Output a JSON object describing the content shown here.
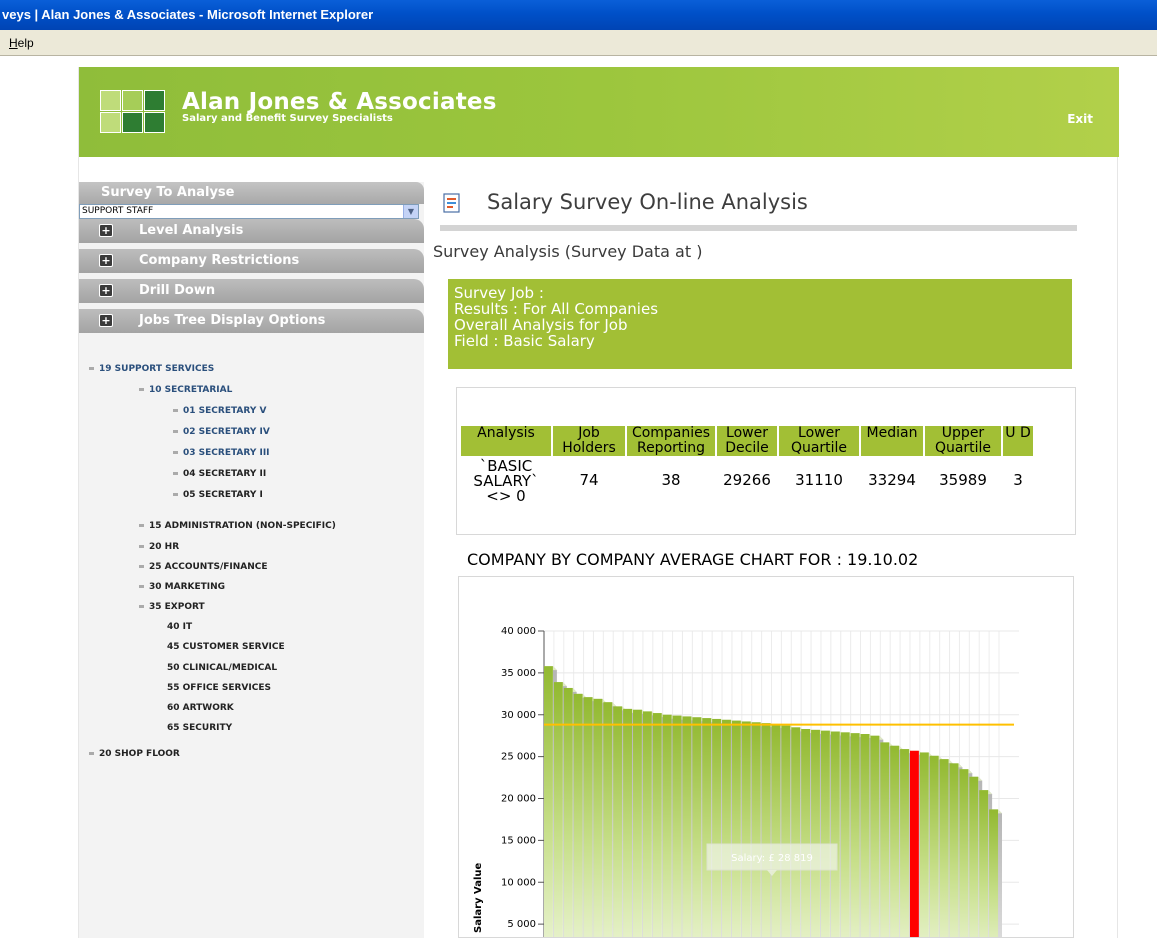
{
  "window": {
    "title": "veys | Alan Jones & Associates - Microsoft Internet Explorer"
  },
  "menu": {
    "help": "Help"
  },
  "header": {
    "brand_name": "Alan Jones & Associates",
    "tagline": "Salary and Benefit Survey Specialists",
    "exit_label": "Exit"
  },
  "sidebar": {
    "survey_heading": "Survey To Analyse",
    "survey_selected": "SUPPORT STAFF",
    "panels": [
      "Level Analysis",
      "Company Restrictions",
      "Drill Down",
      "Jobs Tree Display Options"
    ],
    "tree": [
      "19 SUPPORT SERVICES",
      "10 SECRETARIAL",
      "01 SECRETARY V",
      "02 SECRETARY IV",
      "03 SECRETARY III",
      "04 SECRETARY II",
      "05 SECRETARY I",
      "15 ADMINISTRATION (NON-SPECIFIC)",
      "20 HR",
      "25 ACCOUNTS/FINANCE",
      "30 MARKETING",
      "35 EXPORT",
      "40 IT",
      "45 CUSTOMER SERVICE",
      "50 CLINICAL/MEDICAL",
      "55 OFFICE SERVICES",
      "60 ARTWORK",
      "65 SECURITY",
      "20 SHOP FLOOR"
    ]
  },
  "main": {
    "title": "Salary Survey On-line Analysis",
    "subtitle": "Survey Analysis (Survey Data at )",
    "info_lines": [
      "Survey Job :",
      "Results : For All Companies",
      "Overall Analysis for Job",
      "Field : Basic Salary"
    ],
    "table": {
      "headers": [
        "Analysis",
        "Job Holders",
        "Companies Reporting",
        "Lower Decile",
        "Lower Quartile",
        "Median",
        "Upper Quartile",
        "U D"
      ],
      "row": {
        "analysis": "`BASIC SALARY` <> 0",
        "values": [
          "74",
          "38",
          "29266",
          "31110",
          "33294",
          "35989",
          "3"
        ]
      }
    },
    "chart_heading": "COMPANY BY COMPANY AVERAGE CHART FOR : 19.10.02",
    "tooltip": "Salary: £ 28 819"
  },
  "colors": {
    "brand_green": "#9cc63d",
    "highlight_bar": "#ff0000",
    "average_line": "#ffc000"
  },
  "chart_data": {
    "type": "bar",
    "ylabel": "Salary Value",
    "ylim": [
      0,
      40000
    ],
    "yticks": [
      "5 000",
      "10 000",
      "15 000",
      "20 000",
      "25 000",
      "30 000",
      "35 000",
      "40 000"
    ],
    "average_line": 28819,
    "highlight_index": 37,
    "values": [
      35800,
      33900,
      33200,
      32500,
      32100,
      31900,
      31500,
      31000,
      30700,
      30600,
      30400,
      30200,
      30000,
      29900,
      29800,
      29700,
      29600,
      29500,
      29400,
      29300,
      29200,
      29100,
      29000,
      28900,
      28700,
      28500,
      28300,
      28200,
      28100,
      28000,
      27900,
      27800,
      27700,
      27500,
      26700,
      26300,
      25900,
      25700,
      25500,
      25100,
      24700,
      24200,
      23500,
      22600,
      21000,
      18700
    ]
  }
}
